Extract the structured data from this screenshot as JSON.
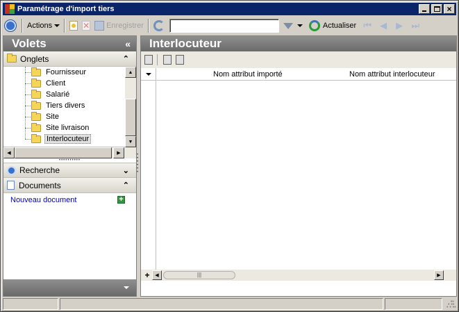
{
  "window": {
    "title": "Paramétrage d'import tiers"
  },
  "toolbar": {
    "actions_label": "Actions",
    "save_label": "Enregistrer",
    "search_value": "",
    "refresh_label": "Actualiser"
  },
  "left_pane": {
    "title": "Volets",
    "onglets_label": "Onglets",
    "tree_items": [
      "Fournisseur",
      "Client",
      "Salarié",
      "Tiers divers",
      "Site",
      "Site livraison",
      "Interlocuteur"
    ],
    "selected_item": "Interlocuteur",
    "recherche_label": "Recherche",
    "documents_label": "Documents",
    "new_document_label": "Nouveau document"
  },
  "right_pane": {
    "title": "Interlocuteur",
    "columns": [
      "Nom attribut importé",
      "Nom attribut interlocuteur"
    ]
  },
  "colors": {
    "titlebar": "#0a246a",
    "header_gray": "#7a7a7a",
    "link_blue": "#0000c0"
  }
}
